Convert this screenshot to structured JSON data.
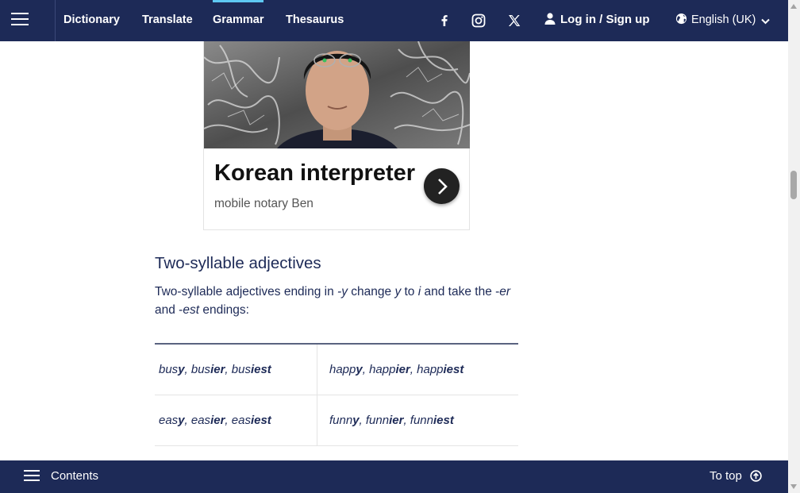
{
  "nav": {
    "links": [
      {
        "label": "Dictionary",
        "active": false
      },
      {
        "label": "Translate",
        "active": false
      },
      {
        "label": "Grammar",
        "active": true
      },
      {
        "label": "Thesaurus",
        "active": false
      }
    ],
    "social_icons": [
      "facebook-icon",
      "instagram-icon",
      "x-twitter-icon"
    ],
    "login_label": "Log in / Sign up",
    "language_label": "English (UK)",
    "accent_color": "#5ec8f2",
    "bar_color": "#1d2a57"
  },
  "ad": {
    "title": "Korean interpreter",
    "subtitle": "mobile notary Ben"
  },
  "article": {
    "heading": "Two-syllable adjectives",
    "para_part1": "Two-syllable adjectives ending in ",
    "para_y1": "-y",
    "para_part2": " change ",
    "para_y2": "y",
    "para_part3": " to ",
    "para_i": "i",
    "para_part4": " and take the -",
    "para_er": "er",
    "para_part5": " and -",
    "para_est": "est",
    "para_part6": " endings:",
    "sep": ", ",
    "examples": [
      [
        [
          [
            "bus",
            "y"
          ],
          [
            "bus",
            "ier"
          ],
          [
            "bus",
            "iest"
          ]
        ],
        [
          [
            "happ",
            "y"
          ],
          [
            "happ",
            "ier"
          ],
          [
            "happ",
            "iest"
          ]
        ]
      ],
      [
        [
          [
            "eas",
            "y"
          ],
          [
            "eas",
            "ier"
          ],
          [
            "eas",
            "iest"
          ]
        ],
        [
          [
            "funn",
            "y"
          ],
          [
            "funn",
            "ier"
          ],
          [
            "funn",
            "iest"
          ]
        ]
      ]
    ]
  },
  "footer": {
    "contents_label": "Contents",
    "to_top_label": "To top"
  }
}
